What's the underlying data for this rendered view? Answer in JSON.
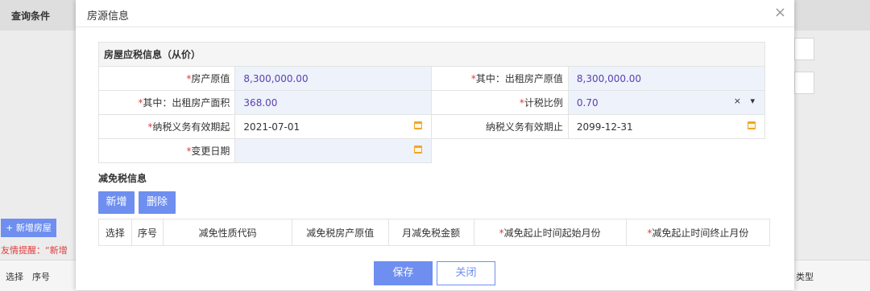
{
  "background": {
    "header_title": "查询条件",
    "add_house_button": "+ 新增房屋",
    "tip_text": "友情提醒：“新增",
    "table_headers": {
      "select": "选择",
      "seq": "序号",
      "type": "类型"
    }
  },
  "modal": {
    "title": "房源信息",
    "close_icon": "×",
    "tax_section": {
      "title": "房屋应税信息（从价）",
      "fields": {
        "original_value": {
          "label": "房产原值",
          "value": "8,300,000.00"
        },
        "rent_original_value": {
          "label": "其中：出租房产原值",
          "value": "8,300,000.00"
        },
        "rent_area": {
          "label": "其中：出租房产面积",
          "value": "368.00"
        },
        "tax_ratio": {
          "label": "计税比例",
          "value": "0.70",
          "controls": "× ▾"
        },
        "obligation_start": {
          "label": "纳税义务有效期起",
          "value": "2021-07-01"
        },
        "obligation_end": {
          "label": "纳税义务有效期止",
          "value": "2099-12-31"
        },
        "change_date": {
          "label": "变更日期",
          "value": ""
        }
      }
    },
    "relief_section": {
      "title": "减免税信息",
      "add_button": "新增",
      "delete_button": "删除",
      "columns": {
        "select": "选择",
        "seq": "序号",
        "code": "减免性质代码",
        "property_value": "减免税房产原值",
        "monthly_amount": "月减免税金额",
        "start_month": "减免起止时间起始月份",
        "end_month": "减免起止时间终止月份"
      }
    },
    "footer": {
      "save_button": "保存",
      "close_button": "关闭"
    }
  },
  "colors": {
    "accent": "#6e8ff0",
    "required": "#e03b3b",
    "value_text": "#5a3fb0",
    "value_bg": "#eef2fb"
  }
}
